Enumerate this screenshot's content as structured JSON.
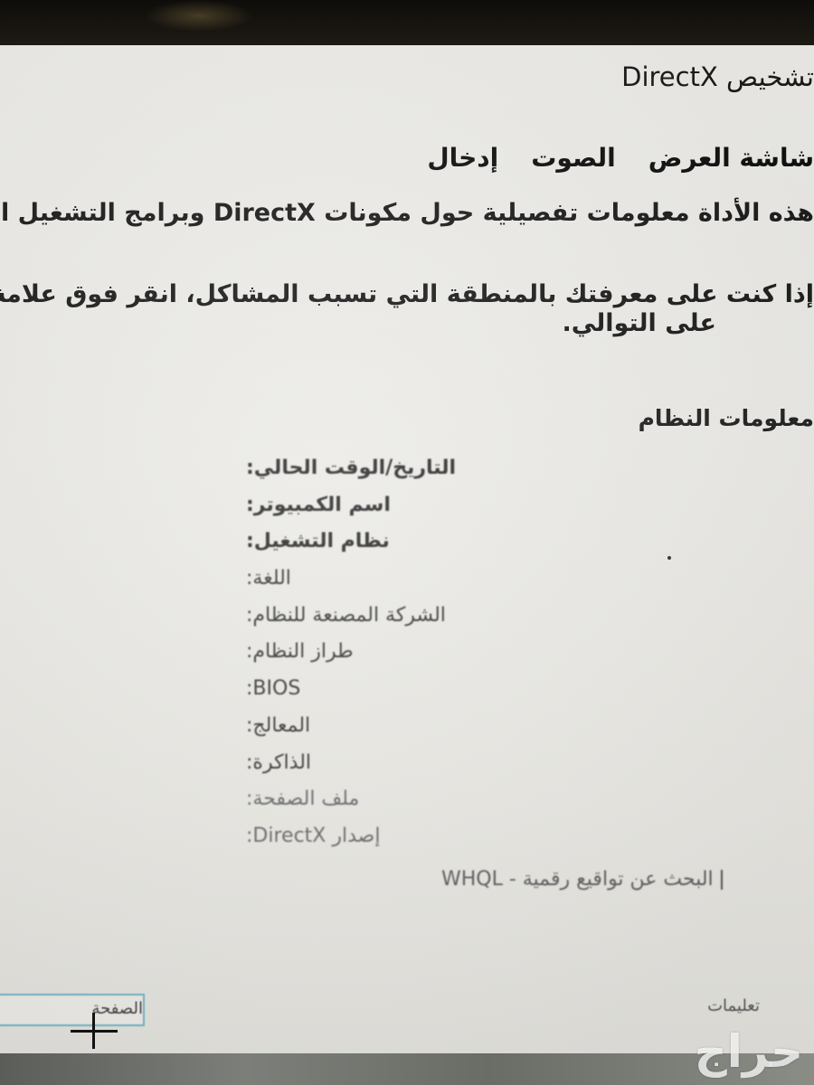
{
  "window": {
    "title": "تشخيص DirectX"
  },
  "tabs": [
    {
      "label": "شاشة العرض"
    },
    {
      "label": "الصوت"
    },
    {
      "label": "إدخال"
    }
  ],
  "intro": {
    "line1": "هذه الأداة معلومات تفصيلية حول مكونات DirectX وبرامج التشغيل المثبتة",
    "line2": "إذا كنت على معرفتك بالمنطقة التي تسبب المشاكل، انقر فوق علامة التبويب المناسبة",
    "line3": "على التوالي."
  },
  "system_info": {
    "heading": "معلومات النظام",
    "rows": [
      {
        "label": "التاريخ/الوقت الحالي:"
      },
      {
        "label": "اسم الكمبيوتر:"
      },
      {
        "label": "نظام التشغيل:"
      },
      {
        "label": "اللغة:"
      },
      {
        "label": "الشركة المصنعة للنظام:"
      },
      {
        "label": "طراز النظام:"
      },
      {
        "label": "BIOS:"
      },
      {
        "label": "المعالج:"
      },
      {
        "label": "الذاكرة:"
      },
      {
        "label": "ملف الصفحة:"
      },
      {
        "label": "إصدار DirectX:"
      }
    ]
  },
  "whql": {
    "label": "البحث عن تواقيع رقمية - WHQL"
  },
  "footer": {
    "left_button": "الصفحة",
    "right_link": "تعليمات"
  },
  "watermark": {
    "text": "حراج"
  }
}
